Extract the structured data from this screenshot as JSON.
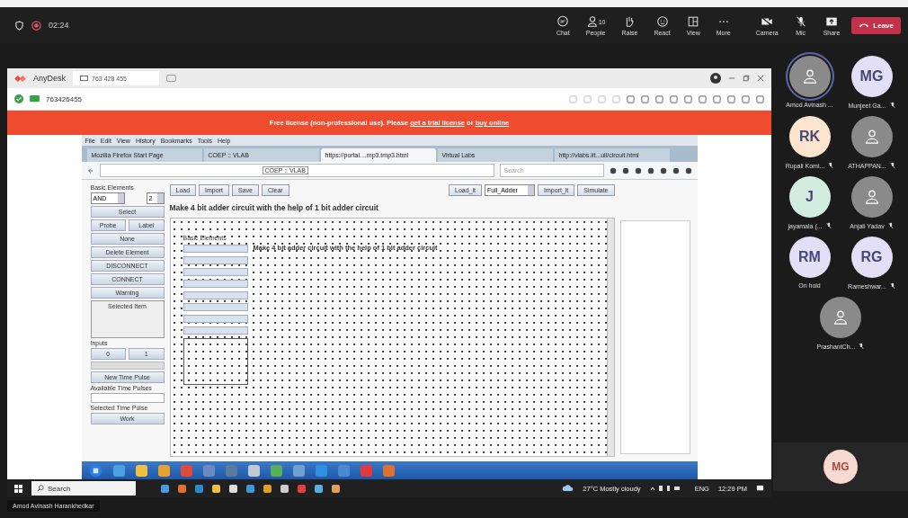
{
  "meeting_bar": {
    "timer": "02:24",
    "controls": [
      {
        "kind": "chat",
        "label": "Chat"
      },
      {
        "kind": "people",
        "label": "People",
        "count": "10"
      },
      {
        "kind": "raise",
        "label": "Raise"
      },
      {
        "kind": "react",
        "label": "React"
      },
      {
        "kind": "view",
        "label": "View"
      },
      {
        "kind": "more",
        "label": "More"
      },
      {
        "kind": "camera",
        "label": "Camera"
      },
      {
        "kind": "mic",
        "label": "Mic"
      },
      {
        "kind": "share",
        "label": "Share"
      }
    ],
    "leave": "Leave"
  },
  "anydesk": {
    "app_name": "AnyDesk",
    "tab": "763 428 455",
    "address": "763426455",
    "banner": {
      "before": "Free license (non-professional use). Please ",
      "link1": "get a trial license",
      "middle": " or ",
      "link2": "buy online"
    }
  },
  "browser": {
    "menu": [
      "File",
      "Edit",
      "View",
      "History",
      "Bookmarks",
      "Tools",
      "Help"
    ],
    "tabs": [
      {
        "title": "Mozilla Firefox Start Page",
        "selected": false
      },
      {
        "title": "COEP :: VLAB",
        "selected": false
      },
      {
        "title": "https://portal....mp3.tmp3.html",
        "selected": true
      },
      {
        "title": "Virtual Labs",
        "selected": false
      },
      {
        "title": "http://vlabs.iit...ull/circuit.html",
        "selected": false
      }
    ],
    "url_badge": "COEP :: VLAB",
    "search_placeholder": "Search"
  },
  "lab": {
    "toolbar_left": [
      "Load",
      "Import",
      "Save",
      "Clear"
    ],
    "toolbar_right": [
      {
        "kind": "button",
        "label": "Load_it"
      },
      {
        "kind": "select",
        "label": "Full_Adder"
      },
      {
        "kind": "button",
        "label": "Import_it"
      },
      {
        "kind": "button",
        "label": "Simulate"
      }
    ],
    "heading": "Make 4 bit adder circuit with the help of 1 bit adder circuit",
    "sidebar": {
      "title": "Basic Elements",
      "gate": "AND",
      "inputs_count": "2",
      "buttons": [
        "Select"
      ],
      "pair": [
        "Probe",
        "Label"
      ],
      "more_buttons": [
        "None",
        "Delete Element",
        "DISCONNECT",
        "CONNECT",
        "Warning"
      ],
      "selected_item": "Selected Item",
      "inputs_title": "Inputs",
      "input_buttons": [
        "0",
        "1"
      ],
      "new_pulse": "New Time Pulse",
      "available_pulses": "Available Time Pulses",
      "selected_pulse": "Selected Time Pulse",
      "work": "Work"
    },
    "canvas_panel_title": "Basic Elements",
    "canvas_heading": "Make 4 bit adder circuit with the help of 1 bit adder circuit"
  },
  "taskbar": {
    "search": "Search",
    "weather": "27°C Mostly cloudy",
    "language": "ENG",
    "time": "12:29 PM"
  },
  "presenter_label": "Amod Avinash Harankhedkar",
  "participants": [
    {
      "kind": "avatar",
      "name": "Amod Avinash ...",
      "color": "#8a8a8a",
      "muted": false,
      "speaking": true
    },
    {
      "kind": "initials",
      "initials": "MG",
      "name": "Munjeet Ga...",
      "color": "#e3dff7",
      "muted": true,
      "speaking": false
    },
    {
      "kind": "initials",
      "initials": "RK",
      "name": "Rupali Komi...",
      "color": "#fbe5cf",
      "muted": true,
      "speaking": false
    },
    {
      "kind": "avatar",
      "name": "ATHAPPAN...",
      "color": "#8a8a8a",
      "muted": true,
      "speaking": false
    },
    {
      "kind": "initials",
      "initials": "J",
      "name": "jayamala (...",
      "color": "#d3ece0",
      "muted": true,
      "speaking": false
    },
    {
      "kind": "avatar",
      "name": "Anjali Yadav",
      "color": "#8a8a8a",
      "muted": true,
      "speaking": false
    },
    {
      "kind": "initials",
      "initials": "RM",
      "name": "On hold",
      "color": "#e3dff7",
      "muted": false,
      "speaking": false
    },
    {
      "kind": "initials",
      "initials": "RG",
      "name": "Rameshwar...",
      "color": "#e3dff7",
      "muted": true,
      "speaking": false
    },
    {
      "kind": "avatar",
      "name": "PrashantCh...",
      "color": "#8a8a8a",
      "muted": true,
      "speaking": false
    }
  ],
  "self_tile": {
    "initials": "MG",
    "color": "#f6d9d0"
  }
}
